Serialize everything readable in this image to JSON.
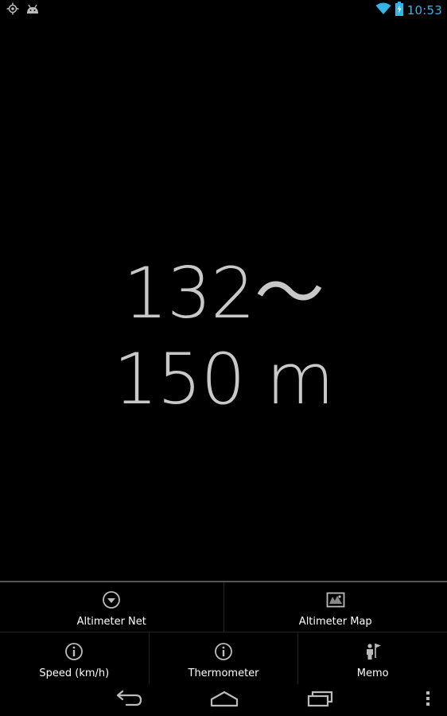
{
  "status_bar": {
    "time": "10:53",
    "left_icons": [
      "gps-icon",
      "android-icon"
    ],
    "right_icons": [
      "wifi-icon",
      "battery-charging-icon"
    ],
    "accent_color": "#33b5e5"
  },
  "reading": {
    "line1": "132～",
    "line2": "150 m"
  },
  "menu": {
    "row1": [
      {
        "label": "Altimeter Net",
        "icon": "dropdown-circle-icon"
      },
      {
        "label": "Altimeter Map",
        "icon": "map-icon"
      }
    ],
    "row2": [
      {
        "label": "Speed (km/h)",
        "icon": "info-icon"
      },
      {
        "label": "Thermometer",
        "icon": "info-icon"
      },
      {
        "label": "Memo",
        "icon": "person-flag-icon"
      }
    ]
  },
  "nav_bar": {
    "buttons": [
      "back-icon",
      "home-icon",
      "recents-icon",
      "overflow-menu-icon"
    ]
  }
}
